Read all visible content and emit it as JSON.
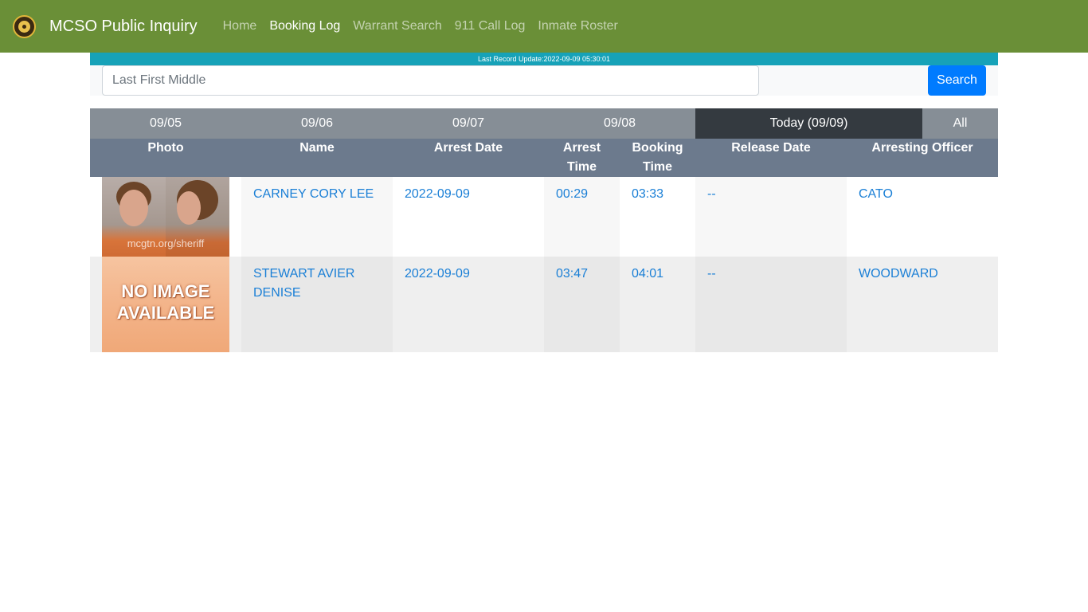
{
  "navbar": {
    "brand": "MCSO Public Inquiry",
    "links": [
      "Home",
      "Booking Log",
      "Warrant Search",
      "911 Call Log",
      "Inmate Roster"
    ],
    "active": "Booking Log",
    "color": "#6a8f37"
  },
  "update_banner": "Last Record Update:2022-09-09 05:30:01",
  "search": {
    "placeholder": "Last First Middle",
    "value": "",
    "button_label": "Search"
  },
  "date_tabs": [
    "09/05",
    "09/06",
    "09/07",
    "09/08",
    "Today (09/09)",
    "All"
  ],
  "active_tab": "Today (09/09)",
  "table": {
    "headers": {
      "photo": "Photo",
      "name": "Name",
      "arrest_date": "Arrest Date",
      "arrest_time": "Arrest Time",
      "booking_time": "Booking Time",
      "release_date": "Release Date",
      "officer": "Arresting Officer"
    },
    "rows": [
      {
        "photo": "mugshot",
        "photo_watermark": "mcgtn.org/sheriff",
        "name": "CARNEY CORY LEE",
        "arrest_date": "2022-09-09",
        "arrest_time": "00:29",
        "booking_time": "03:33",
        "release_date": "--",
        "officer": "CATO"
      },
      {
        "photo": "no-image",
        "photo_text": "NO IMAGE AVAILABLE",
        "name": "STEWART AVIER DENISE",
        "arrest_date": "2022-09-09",
        "arrest_time": "03:47",
        "booking_time": "04:01",
        "release_date": "--",
        "officer": "WOODWARD"
      }
    ]
  }
}
